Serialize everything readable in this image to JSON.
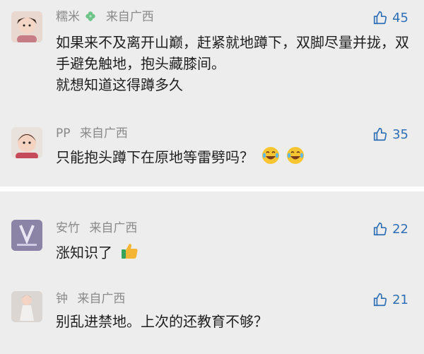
{
  "comments": [
    {
      "user": "糯米",
      "badge": "clover-icon",
      "source": "来自广西",
      "likes": "45",
      "text": [
        "如果来不及离开山巅，赶紧就地蹲下，双脚尽量并拢，双手避免触地，抱头藏膝间。",
        "就想知道这得蹲多久"
      ]
    },
    {
      "user": "PP",
      "source": "来自广西",
      "likes": "35",
      "text": [
        "只能抱头蹲下在原地等雷劈吗？"
      ],
      "emoji": [
        "laughing-tears-emoji",
        "laughing-tears-emoji"
      ]
    },
    {
      "user": "安竹",
      "source": "来自广西",
      "likes": "22",
      "text": [
        "涨知识了"
      ],
      "emoji": [
        "thumbs-up-emoji"
      ]
    },
    {
      "user": "钟",
      "source": "来自广西",
      "likes": "21",
      "text": [
        "别乱进禁地。上次的还教育不够？"
      ]
    }
  ],
  "colors": {
    "background": "#ededed",
    "like": "#2f6fb6",
    "meta": "#8a8a8a",
    "text": "#1f1f1f",
    "divider": "#ffffff"
  }
}
